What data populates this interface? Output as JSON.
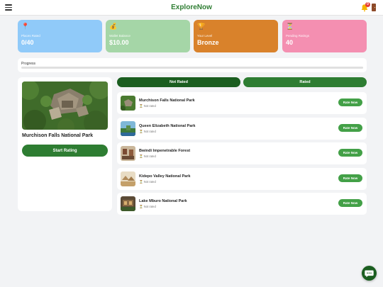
{
  "header": {
    "title": "ExploreNow",
    "notification_count": "0"
  },
  "stats": [
    {
      "icon": "📍",
      "label": "Places Rated",
      "value": "0/40",
      "color": "#90caf9"
    },
    {
      "icon": "💰",
      "label": "Wallet Balance",
      "value": "$10.00",
      "color": "#a5d6a7"
    },
    {
      "icon": "🏆",
      "label": "Your Level",
      "value": "Bronze",
      "color": "#d9822b"
    },
    {
      "icon": "⏳",
      "label": "Pending Ratings",
      "value": "40",
      "color": "#f48fb1"
    }
  ],
  "progress": {
    "label": "Progress",
    "value": 0
  },
  "featured": {
    "title": "Murchison Falls National Park",
    "button": "Start Rating"
  },
  "tabs": {
    "not_rated": "Not Rated",
    "rated": "Rated"
  },
  "parks": [
    {
      "name": "Murchison Falls National Park",
      "status": "Not rated",
      "button": "Rate Now"
    },
    {
      "name": "Queen Elizabeth National Park",
      "status": "Not rated",
      "button": "Rate Now"
    },
    {
      "name": "Bwindi Impenetrable Forest",
      "status": "Not rated",
      "button": "Rate Now"
    },
    {
      "name": "Kidepo Valley National Park",
      "status": "Not rated",
      "button": "Rate Now"
    },
    {
      "name": "Lake Mburo National Park",
      "status": "Not rated",
      "button": "Rate Now"
    }
  ],
  "colors": {
    "primary": "#2e7d32",
    "accent": "#43a047",
    "tab_inactive": "#2e7d32",
    "tab_active": "#1b5e20"
  }
}
